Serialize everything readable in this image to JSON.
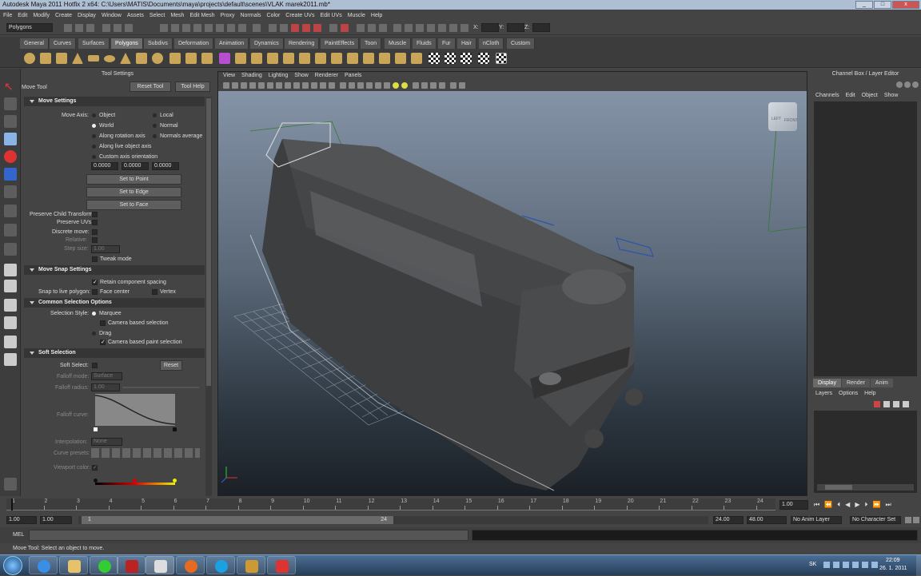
{
  "window": {
    "title": "Autodesk Maya 2011 Hotfix 2 x64: C:\\Users\\MATIS\\Documents\\maya\\projects\\default\\scenes\\VLAK marek2011.mb*"
  },
  "menubar": [
    "File",
    "Edit",
    "Modify",
    "Create",
    "Display",
    "Window",
    "Assets",
    "Select",
    "Mesh",
    "Edit Mesh",
    "Proxy",
    "Normals",
    "Color",
    "Create UVs",
    "Edit UVs",
    "Muscle",
    "Help"
  ],
  "statusline": {
    "mode": "Polygons",
    "x_label": "X:",
    "y_label": "Y:",
    "z_label": "Z:"
  },
  "shelf_tabs": [
    "General",
    "Curves",
    "Surfaces",
    "Polygons",
    "Subdivs",
    "Deformation",
    "Animation",
    "Dynamics",
    "Rendering",
    "PaintEffects",
    "Toon",
    "Muscle",
    "Fluids",
    "Fur",
    "Hair",
    "nCloth",
    "Custom"
  ],
  "shelf_active": "Polygons",
  "tool_settings": {
    "header": "Tool Settings",
    "tool_name": "Move Tool",
    "reset_tool": "Reset Tool",
    "tool_help": "Tool Help",
    "move_settings": {
      "title": "Move Settings",
      "move_axis_label": "Move Axis:",
      "object": "Object",
      "local": "Local",
      "world": "World",
      "normal": "Normal",
      "along_rotation_axis": "Along rotation axis",
      "normals_average": "Normals average",
      "along_live_object_axis": "Along live object axis",
      "custom_axis_orientation": "Custom axis orientation",
      "v1": "0.0000",
      "v2": "0.0000",
      "v3": "0.0000",
      "set_to_point": "Set to Point",
      "set_to_edge": "Set to Edge",
      "set_to_face": "Set to Face",
      "preserve_child_transform": "Preserve Child Transform",
      "preserve_uvs": "Preserve UVs",
      "discrete_move": "Discrete move:",
      "relative": "Relative:",
      "step_size": "Step size:",
      "step_size_value": "1.00",
      "tweak_mode": "Tweak mode"
    },
    "move_snap_settings": {
      "title": "Move Snap Settings",
      "retain_component_spacing": "Retain component spacing",
      "snap_to_live_polygon": "Snap to live polygon:",
      "face_center": "Face center",
      "vertex": "Vertex"
    },
    "common_selection_options": {
      "title": "Common Selection Options",
      "selection_style": "Selection Style:",
      "marquee": "Marquee",
      "camera_based_selection": "Camera based selection",
      "drag": "Drag",
      "camera_based_paint_selection": "Camera based paint selection"
    },
    "soft_selection": {
      "title": "Soft Selection",
      "soft_select": "Soft Select:",
      "reset": "Reset",
      "falloff_mode": "Falloff mode:",
      "falloff_mode_value": "Surface",
      "falloff_radius": "Falloff radius:",
      "falloff_radius_value": "1.00",
      "falloff_curve": "Falloff curve:",
      "interpolation": "Interpolation:",
      "interpolation_value": "None",
      "curve_presets": "Curve presets:",
      "viewport_color": "Viewport color:"
    }
  },
  "viewport": {
    "menu": [
      "View",
      "Shading",
      "Lighting",
      "Show",
      "Renderer",
      "Panels"
    ],
    "viewcube_left": "LEFT",
    "viewcube_front": "FRONT"
  },
  "channel_box": {
    "title": "Channel Box / Layer Editor",
    "menu": [
      "Channels",
      "Edit",
      "Object",
      "Show"
    ]
  },
  "layer_editor": {
    "tabs": [
      "Display",
      "Render",
      "Anim"
    ],
    "active_tab": "Display",
    "menu": [
      "Layers",
      "Options",
      "Help"
    ]
  },
  "timeline": {
    "ticks": [
      "1",
      "2",
      "3",
      "4",
      "5",
      "6",
      "7",
      "8",
      "9",
      "10",
      "11",
      "12",
      "13",
      "14",
      "15",
      "16",
      "17",
      "18",
      "19",
      "20",
      "21",
      "22",
      "23",
      "24"
    ],
    "current_frame": "1.00"
  },
  "range": {
    "start": "1.00",
    "start2": "1.00",
    "slider_start": "1",
    "slider_end": "24",
    "end": "24.00",
    "end2": "48.00",
    "anim_layer": "No Anim Layer",
    "character_set": "No Character Set"
  },
  "command_line": {
    "label": "MEL"
  },
  "help_line": "Move Tool: Select an object to move.",
  "taskbar": {
    "lang": "SK",
    "time": "22:09",
    "date": "26. 1. 2011"
  },
  "colors": {
    "accent": "#6d6d6d",
    "bg": "#444444",
    "taskbar": "#2f4a6a"
  }
}
